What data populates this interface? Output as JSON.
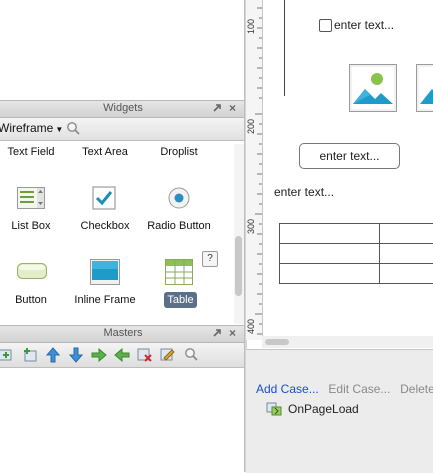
{
  "widgets_panel": {
    "title": "Widgets",
    "library": "Wireframe",
    "items": [
      {
        "label": "Text Field"
      },
      {
        "label": "Text Area"
      },
      {
        "label": "Droplist"
      },
      {
        "label": "List Box"
      },
      {
        "label": "Checkbox"
      },
      {
        "label": "Radio Button"
      },
      {
        "label": "Button"
      },
      {
        "label": "Inline Frame"
      },
      {
        "label": "Table"
      }
    ],
    "help_badge": "?"
  },
  "masters_panel": {
    "title": "Masters"
  },
  "ruler": {
    "marks": [
      "100",
      "200",
      "300",
      "400"
    ]
  },
  "canvas": {
    "checkbox_text": "enter text...",
    "button_text": "enter text...",
    "label_text": "enter text..."
  },
  "interactions": {
    "add_case": "Add Case...",
    "edit_case": "Edit Case...",
    "delete_case": "Delete Ca",
    "event": "OnPageLoad"
  },
  "colors": {
    "accent_blue": "#1b4fc9",
    "selected_label": "#5c6f88",
    "panel_header": "#dcdcdc"
  }
}
